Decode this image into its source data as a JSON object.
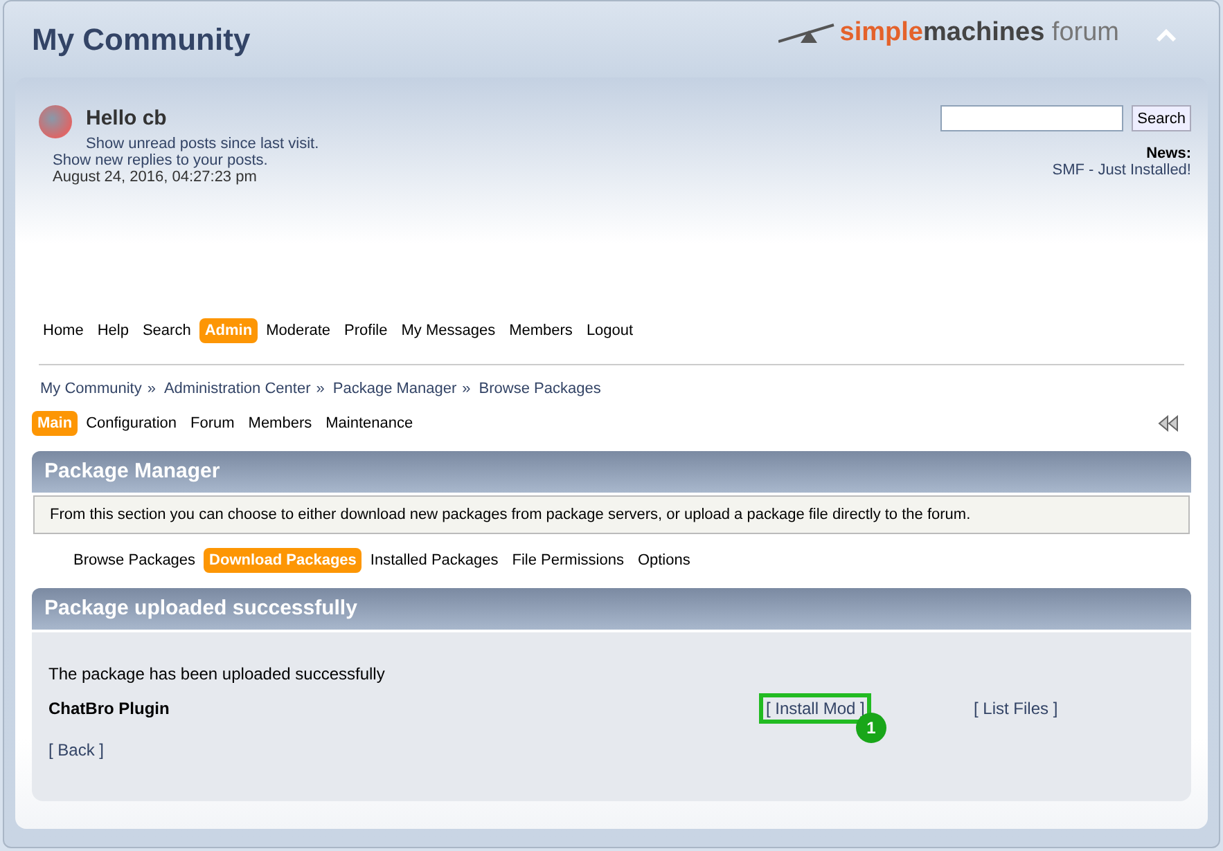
{
  "header": {
    "title": "My Community",
    "logo": {
      "part_1": "simple",
      "part_2": "machines",
      "part_3": "forum"
    }
  },
  "user": {
    "greeting": "Hello cb",
    "links": [
      "Show unread posts since last visit.",
      "Show new replies to your posts."
    ],
    "date": "August 24, 2016, 04:27:23 pm"
  },
  "search": {
    "button": "Search"
  },
  "news": {
    "label": "News:",
    "text": "SMF - Just Installed!"
  },
  "main_menu": [
    {
      "label": "Home",
      "selected": false
    },
    {
      "label": "Help",
      "selected": false
    },
    {
      "label": "Search",
      "selected": false
    },
    {
      "label": "Admin",
      "selected": true
    },
    {
      "label": "Moderate",
      "selected": false
    },
    {
      "label": "Profile",
      "selected": false
    },
    {
      "label": "My Messages",
      "selected": false
    },
    {
      "label": "Members",
      "selected": false
    },
    {
      "label": "Logout",
      "selected": false
    }
  ],
  "breadcrumb": [
    "My Community",
    "Administration Center",
    "Package Manager",
    "Browse Packages"
  ],
  "breadcrumb_separator": "»",
  "admin_tabs": [
    {
      "label": "Main",
      "selected": true
    },
    {
      "label": "Configuration",
      "selected": false
    },
    {
      "label": "Forum",
      "selected": false
    },
    {
      "label": "Members",
      "selected": false
    },
    {
      "label": "Maintenance",
      "selected": false
    }
  ],
  "package_manager": {
    "title": "Package Manager",
    "description": "From this section you can choose to either download new packages from package servers, or upload a package file directly to the forum.",
    "tabs": [
      {
        "label": "Browse Packages",
        "selected": false
      },
      {
        "label": "Download Packages",
        "selected": true
      },
      {
        "label": "Installed Packages",
        "selected": false
      },
      {
        "label": "File Permissions",
        "selected": false
      },
      {
        "label": "Options",
        "selected": false
      }
    ]
  },
  "upload_result": {
    "title": "Package uploaded successfully",
    "message": "The package has been uploaded successfully",
    "package_name": "ChatBro Plugin",
    "actions": [
      {
        "label": "[ Install Mod ]",
        "highlighted": true,
        "annotation": "1"
      },
      {
        "label": "[ List Files ]",
        "highlighted": false
      }
    ],
    "back": "[ Back ]"
  }
}
